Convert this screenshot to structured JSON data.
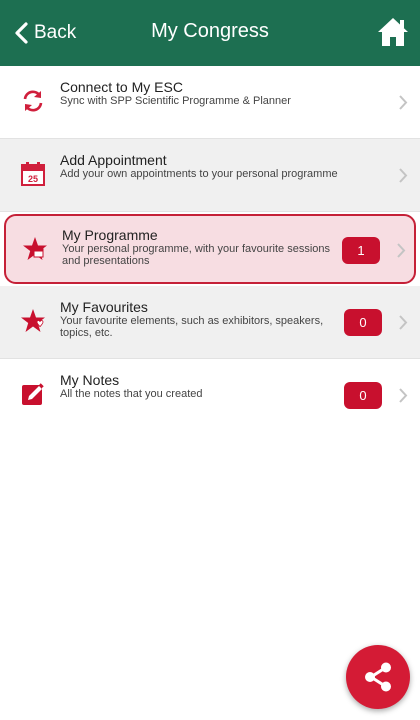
{
  "header": {
    "back_label": "Back",
    "title": "My Congress",
    "home_icon": "home-icon"
  },
  "items": [
    {
      "title": "Connect to My ESC",
      "subtitle": "Sync with SPP Scientific Programme & Planner",
      "icon": "sync-icon",
      "badge": null
    },
    {
      "title": "Add Appointment",
      "subtitle": "Add your own appointments to your personal programme",
      "icon": "calendar-icon",
      "icon_text": "25",
      "badge": null
    },
    {
      "title": "My Programme",
      "subtitle": "Your personal programme, with your favourite sessions and presentations",
      "icon": "star-calendar-icon",
      "badge": "1",
      "selected": true
    },
    {
      "title": "My Favourites",
      "subtitle": "Your favourite elements, such as exhibitors, speakers, topics, etc.",
      "icon": "star-heart-icon",
      "badge": "0"
    },
    {
      "title": "My Notes",
      "subtitle": "All the notes that you created",
      "icon": "note-pencil-icon",
      "badge": "0"
    }
  ],
  "fab": {
    "icon": "share-icon"
  },
  "colors": {
    "header_bg": "#1d6f51",
    "accent_red": "#c8102e",
    "selected_bg": "#f7dde2"
  }
}
